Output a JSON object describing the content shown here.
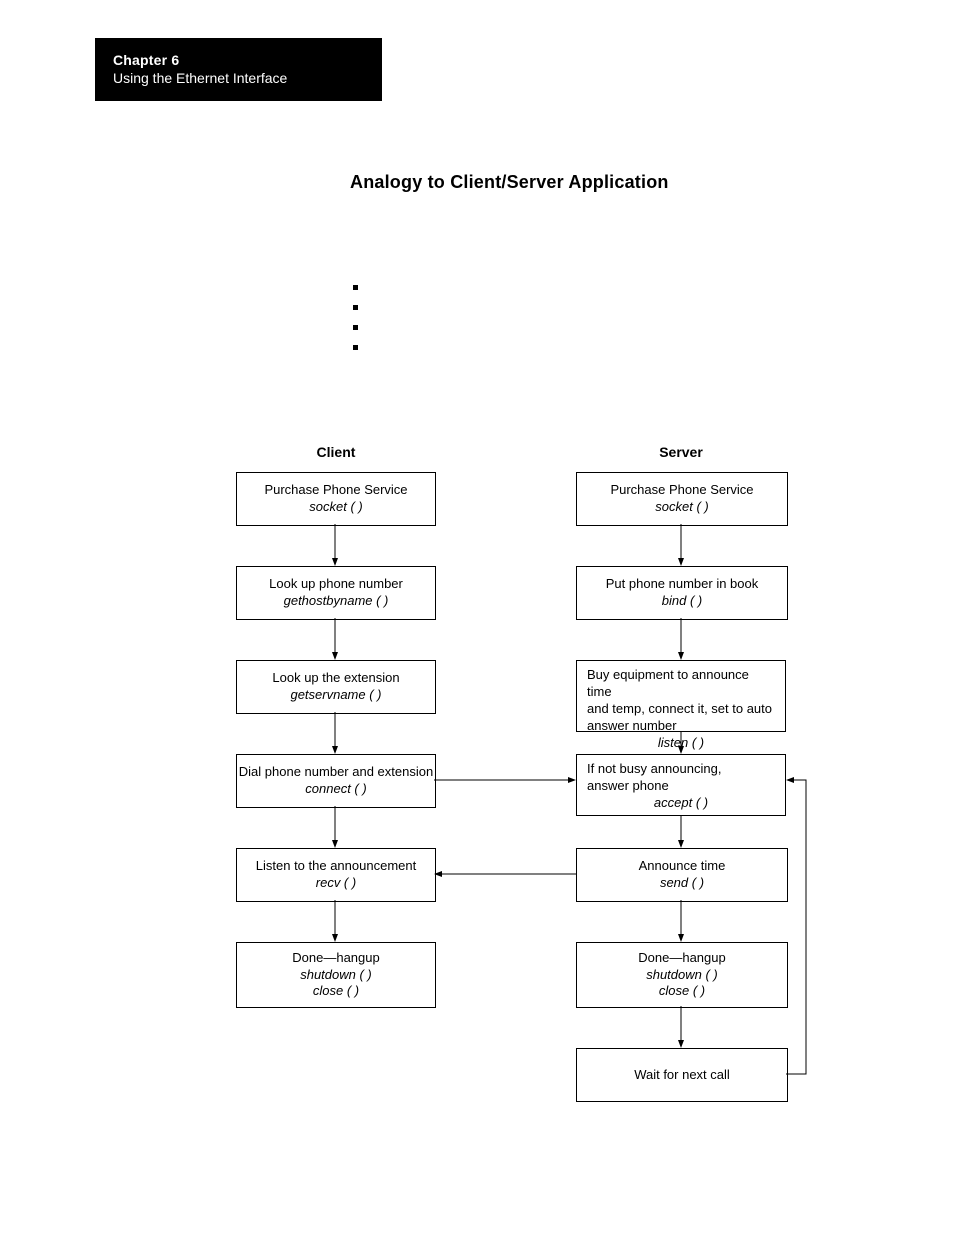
{
  "chapter": {
    "line1": "Chapter  6",
    "line2": "Using the Ethernet Interface"
  },
  "headline": "Analogy to Client/Server Application",
  "columns": {
    "client": "Client",
    "server": "Server"
  },
  "client": {
    "b1": {
      "text": "Purchase Phone Service",
      "fn": "socket ( )"
    },
    "b2": {
      "text": "Look up phone number",
      "fn": "gethostbyname ( )"
    },
    "b3": {
      "text": "Look up the extension",
      "fn": "getservname ( )"
    },
    "b4": {
      "text": "Dial phone number and extension",
      "fn": "connect ( )"
    },
    "b5": {
      "text": "Listen to the announcement",
      "fn": "recv ( )"
    },
    "b6": {
      "text": "Done—hangup",
      "fn1": "shutdown ( )",
      "fn2": "close ( )"
    }
  },
  "server": {
    "b1": {
      "text": "Purchase Phone Service",
      "fn": "socket ( )"
    },
    "b2": {
      "text": "Put phone number in book",
      "fn": "bind ( )"
    },
    "b3": {
      "l1": "Buy equipment to announce time",
      "l2": "and temp, connect it, set to auto",
      "l3": "answer number",
      "fn": "listen ( )"
    },
    "b4": {
      "l1": "If not busy announcing,",
      "l2": "answer phone",
      "fn": "accept ( )"
    },
    "b5": {
      "text": "Announce time",
      "fn": "send ( )"
    },
    "b6": {
      "text": "Done—hangup",
      "fn1": "shutdown ( )",
      "fn2": "close ( )"
    },
    "b7": {
      "text": "Wait for next call"
    }
  }
}
